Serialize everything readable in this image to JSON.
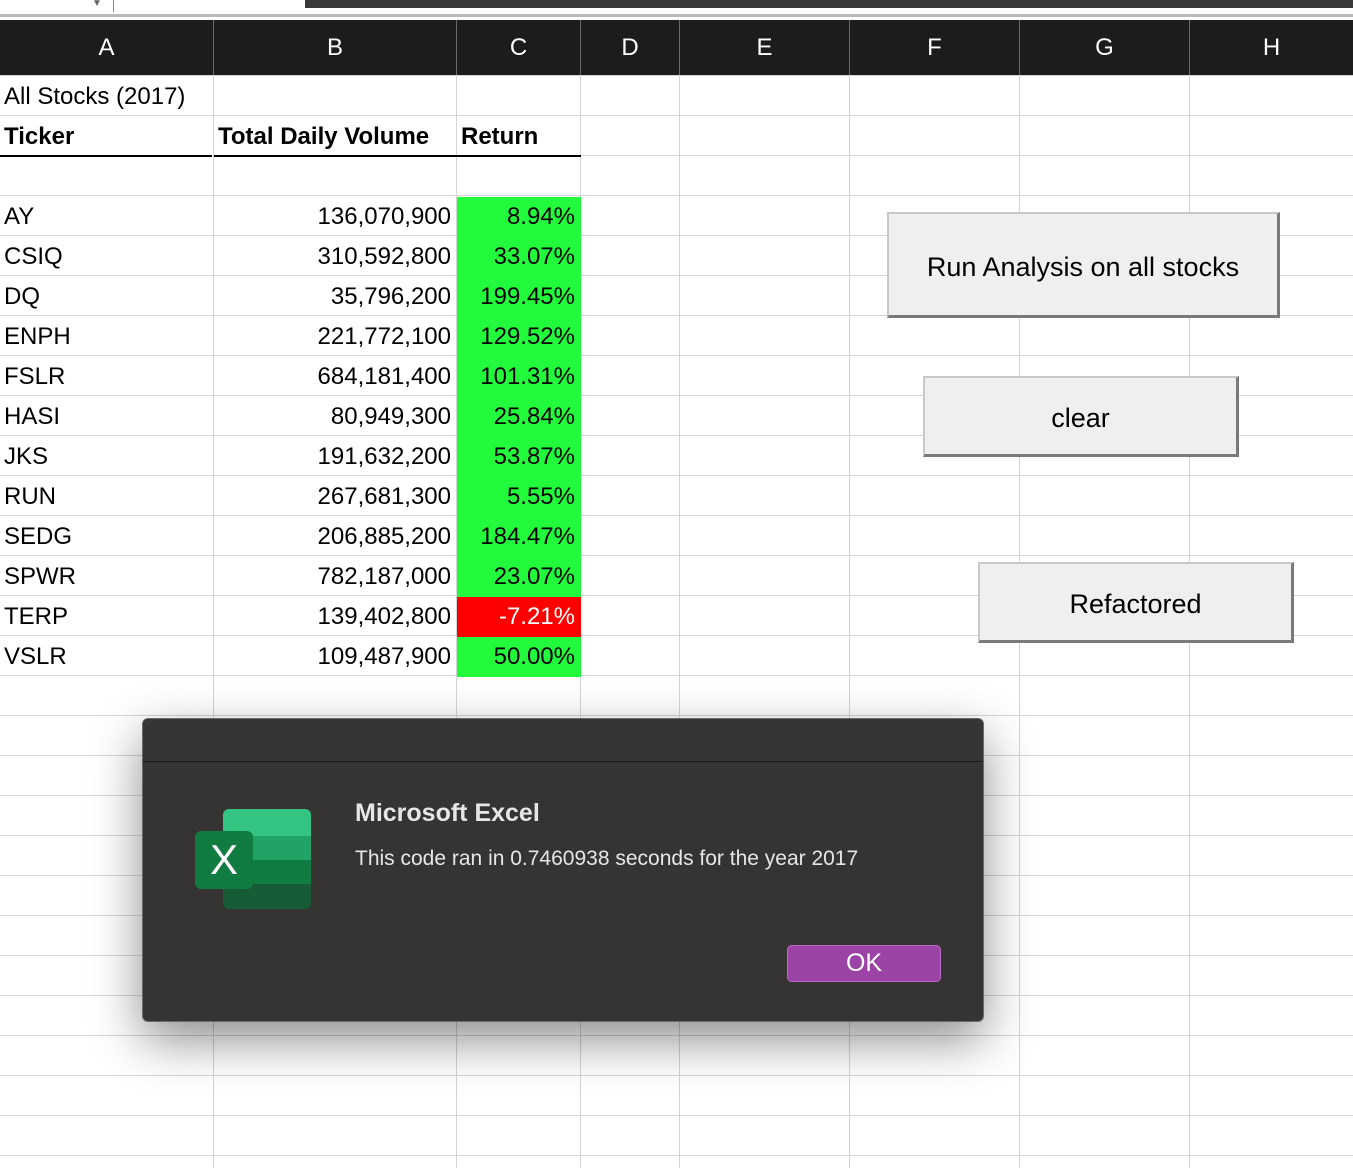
{
  "columns": [
    "A",
    "B",
    "C",
    "D",
    "E",
    "F",
    "G",
    "H"
  ],
  "sheet": {
    "title": "All Stocks (2017)",
    "headers": {
      "ticker": "Ticker",
      "volume": "Total Daily Volume",
      "return": "Return"
    },
    "rows": [
      {
        "ticker": "AY",
        "volume": "136,070,900",
        "return": "8.94%",
        "status": "positive"
      },
      {
        "ticker": "CSIQ",
        "volume": "310,592,800",
        "return": "33.07%",
        "status": "positive"
      },
      {
        "ticker": "DQ",
        "volume": "35,796,200",
        "return": "199.45%",
        "status": "positive"
      },
      {
        "ticker": "ENPH",
        "volume": "221,772,100",
        "return": "129.52%",
        "status": "positive"
      },
      {
        "ticker": "FSLR",
        "volume": "684,181,400",
        "return": "101.31%",
        "status": "positive"
      },
      {
        "ticker": "HASI",
        "volume": "80,949,300",
        "return": "25.84%",
        "status": "positive"
      },
      {
        "ticker": "JKS",
        "volume": "191,632,200",
        "return": "53.87%",
        "status": "positive"
      },
      {
        "ticker": "RUN",
        "volume": "267,681,300",
        "return": "5.55%",
        "status": "positive"
      },
      {
        "ticker": "SEDG",
        "volume": "206,885,200",
        "return": "184.47%",
        "status": "positive"
      },
      {
        "ticker": "SPWR",
        "volume": "782,187,000",
        "return": "23.07%",
        "status": "positive"
      },
      {
        "ticker": "TERP",
        "volume": "139,402,800",
        "return": "-7.21%",
        "status": "negative"
      },
      {
        "ticker": "VSLR",
        "volume": "109,487,900",
        "return": "50.00%",
        "status": "positive"
      }
    ]
  },
  "buttons": {
    "run_all": "Run Analysis on all stocks",
    "clear": "clear",
    "refactored": "Refactored"
  },
  "dialog": {
    "title": "Microsoft Excel",
    "message": "This code ran in 0.7460938 seconds for the year 2017",
    "ok_label": "OK",
    "icon": "excel-app-icon"
  },
  "colors": {
    "positive_fill": "#22fb3c",
    "negative_fill": "#ff0000",
    "header_bg": "#1c1c1c",
    "dialog_bg": "#353433",
    "ok_button": "#9b44a6"
  }
}
